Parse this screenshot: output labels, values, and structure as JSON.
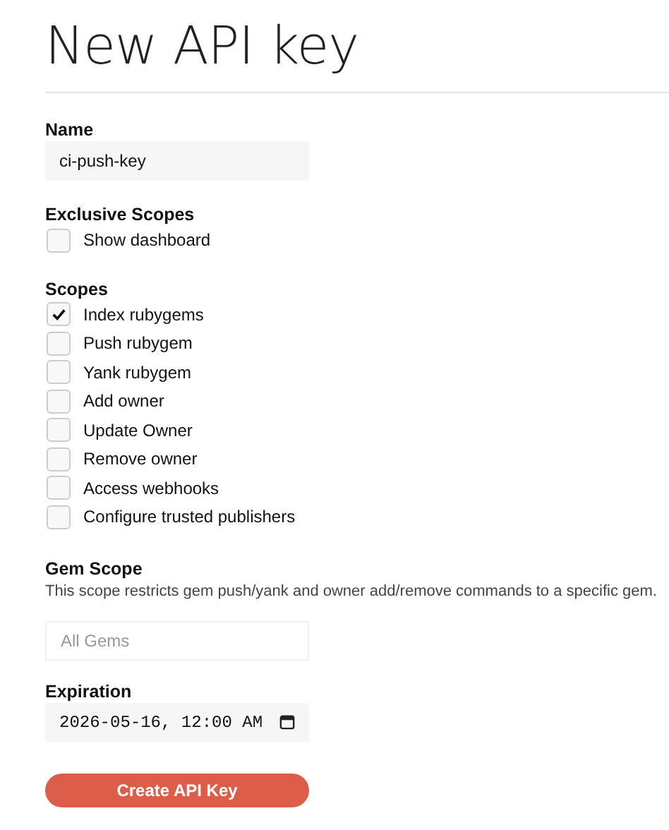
{
  "title": "New API key",
  "name_field": {
    "label": "Name",
    "value": "ci-push-key"
  },
  "exclusive_scopes": {
    "label": "Exclusive Scopes",
    "items": [
      {
        "label": "Show dashboard",
        "checked": false
      }
    ]
  },
  "scopes": {
    "label": "Scopes",
    "items": [
      {
        "label": "Index rubygems",
        "checked": true
      },
      {
        "label": "Push rubygem",
        "checked": false
      },
      {
        "label": "Yank rubygem",
        "checked": false
      },
      {
        "label": "Add owner",
        "checked": false
      },
      {
        "label": "Update Owner",
        "checked": false
      },
      {
        "label": "Remove owner",
        "checked": false
      },
      {
        "label": "Access webhooks",
        "checked": false
      },
      {
        "label": "Configure trusted publishers",
        "checked": false
      }
    ]
  },
  "gem_scope": {
    "label": "Gem Scope",
    "description": "This scope restricts gem push/yank and owner add/remove commands to a specific gem.",
    "placeholder": "All Gems"
  },
  "expiration": {
    "label": "Expiration",
    "value": "2026-05-16, 12:00 AM"
  },
  "submit_button": "Create API Key"
}
